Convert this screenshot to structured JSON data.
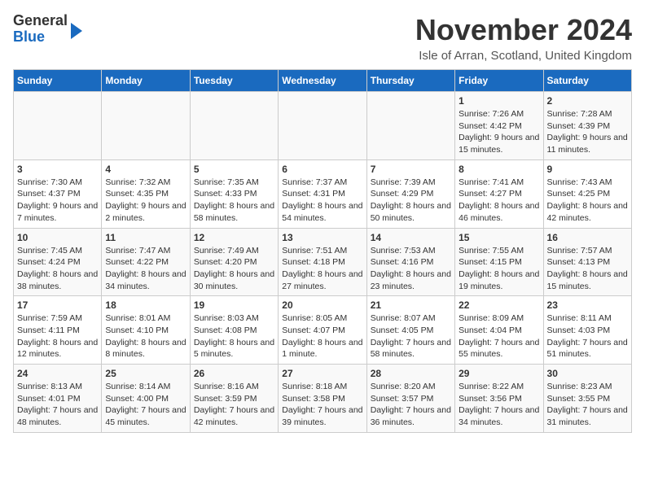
{
  "logo": {
    "line1": "General",
    "line2": "Blue"
  },
  "title": "November 2024",
  "location": "Isle of Arran, Scotland, United Kingdom",
  "days_of_week": [
    "Sunday",
    "Monday",
    "Tuesday",
    "Wednesday",
    "Thursday",
    "Friday",
    "Saturday"
  ],
  "weeks": [
    [
      {
        "day": "",
        "info": ""
      },
      {
        "day": "",
        "info": ""
      },
      {
        "day": "",
        "info": ""
      },
      {
        "day": "",
        "info": ""
      },
      {
        "day": "",
        "info": ""
      },
      {
        "day": "1",
        "info": "Sunrise: 7:26 AM\nSunset: 4:42 PM\nDaylight: 9 hours and 15 minutes."
      },
      {
        "day": "2",
        "info": "Sunrise: 7:28 AM\nSunset: 4:39 PM\nDaylight: 9 hours and 11 minutes."
      }
    ],
    [
      {
        "day": "3",
        "info": "Sunrise: 7:30 AM\nSunset: 4:37 PM\nDaylight: 9 hours and 7 minutes."
      },
      {
        "day": "4",
        "info": "Sunrise: 7:32 AM\nSunset: 4:35 PM\nDaylight: 9 hours and 2 minutes."
      },
      {
        "day": "5",
        "info": "Sunrise: 7:35 AM\nSunset: 4:33 PM\nDaylight: 8 hours and 58 minutes."
      },
      {
        "day": "6",
        "info": "Sunrise: 7:37 AM\nSunset: 4:31 PM\nDaylight: 8 hours and 54 minutes."
      },
      {
        "day": "7",
        "info": "Sunrise: 7:39 AM\nSunset: 4:29 PM\nDaylight: 8 hours and 50 minutes."
      },
      {
        "day": "8",
        "info": "Sunrise: 7:41 AM\nSunset: 4:27 PM\nDaylight: 8 hours and 46 minutes."
      },
      {
        "day": "9",
        "info": "Sunrise: 7:43 AM\nSunset: 4:25 PM\nDaylight: 8 hours and 42 minutes."
      }
    ],
    [
      {
        "day": "10",
        "info": "Sunrise: 7:45 AM\nSunset: 4:24 PM\nDaylight: 8 hours and 38 minutes."
      },
      {
        "day": "11",
        "info": "Sunrise: 7:47 AM\nSunset: 4:22 PM\nDaylight: 8 hours and 34 minutes."
      },
      {
        "day": "12",
        "info": "Sunrise: 7:49 AM\nSunset: 4:20 PM\nDaylight: 8 hours and 30 minutes."
      },
      {
        "day": "13",
        "info": "Sunrise: 7:51 AM\nSunset: 4:18 PM\nDaylight: 8 hours and 27 minutes."
      },
      {
        "day": "14",
        "info": "Sunrise: 7:53 AM\nSunset: 4:16 PM\nDaylight: 8 hours and 23 minutes."
      },
      {
        "day": "15",
        "info": "Sunrise: 7:55 AM\nSunset: 4:15 PM\nDaylight: 8 hours and 19 minutes."
      },
      {
        "day": "16",
        "info": "Sunrise: 7:57 AM\nSunset: 4:13 PM\nDaylight: 8 hours and 15 minutes."
      }
    ],
    [
      {
        "day": "17",
        "info": "Sunrise: 7:59 AM\nSunset: 4:11 PM\nDaylight: 8 hours and 12 minutes."
      },
      {
        "day": "18",
        "info": "Sunrise: 8:01 AM\nSunset: 4:10 PM\nDaylight: 8 hours and 8 minutes."
      },
      {
        "day": "19",
        "info": "Sunrise: 8:03 AM\nSunset: 4:08 PM\nDaylight: 8 hours and 5 minutes."
      },
      {
        "day": "20",
        "info": "Sunrise: 8:05 AM\nSunset: 4:07 PM\nDaylight: 8 hours and 1 minute."
      },
      {
        "day": "21",
        "info": "Sunrise: 8:07 AM\nSunset: 4:05 PM\nDaylight: 7 hours and 58 minutes."
      },
      {
        "day": "22",
        "info": "Sunrise: 8:09 AM\nSunset: 4:04 PM\nDaylight: 7 hours and 55 minutes."
      },
      {
        "day": "23",
        "info": "Sunrise: 8:11 AM\nSunset: 4:03 PM\nDaylight: 7 hours and 51 minutes."
      }
    ],
    [
      {
        "day": "24",
        "info": "Sunrise: 8:13 AM\nSunset: 4:01 PM\nDaylight: 7 hours and 48 minutes."
      },
      {
        "day": "25",
        "info": "Sunrise: 8:14 AM\nSunset: 4:00 PM\nDaylight: 7 hours and 45 minutes."
      },
      {
        "day": "26",
        "info": "Sunrise: 8:16 AM\nSunset: 3:59 PM\nDaylight: 7 hours and 42 minutes."
      },
      {
        "day": "27",
        "info": "Sunrise: 8:18 AM\nSunset: 3:58 PM\nDaylight: 7 hours and 39 minutes."
      },
      {
        "day": "28",
        "info": "Sunrise: 8:20 AM\nSunset: 3:57 PM\nDaylight: 7 hours and 36 minutes."
      },
      {
        "day": "29",
        "info": "Sunrise: 8:22 AM\nSunset: 3:56 PM\nDaylight: 7 hours and 34 minutes."
      },
      {
        "day": "30",
        "info": "Sunrise: 8:23 AM\nSunset: 3:55 PM\nDaylight: 7 hours and 31 minutes."
      }
    ]
  ]
}
